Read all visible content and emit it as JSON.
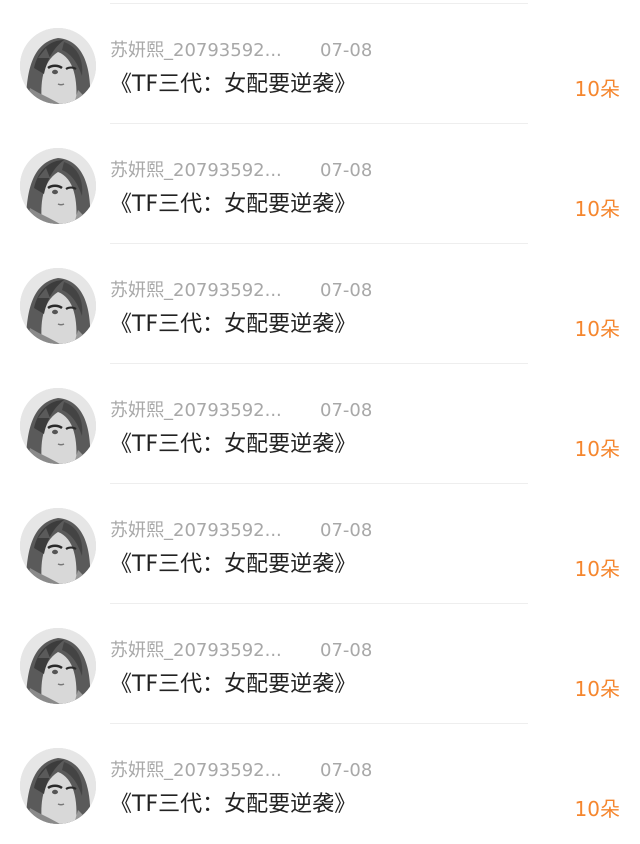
{
  "rows": [
    {
      "username": "苏妍熙_20793592...",
      "date": "07-08",
      "title": "《TF三代：女配要逆袭》",
      "amount": "10朵"
    },
    {
      "username": "苏妍熙_20793592...",
      "date": "07-08",
      "title": "《TF三代：女配要逆袭》",
      "amount": "10朵"
    },
    {
      "username": "苏妍熙_20793592...",
      "date": "07-08",
      "title": "《TF三代：女配要逆袭》",
      "amount": "10朵"
    },
    {
      "username": "苏妍熙_20793592...",
      "date": "07-08",
      "title": "《TF三代：女配要逆袭》",
      "amount": "10朵"
    },
    {
      "username": "苏妍熙_20793592...",
      "date": "07-08",
      "title": "《TF三代：女配要逆袭》",
      "amount": "10朵"
    },
    {
      "username": "苏妍熙_20793592...",
      "date": "07-08",
      "title": "《TF三代：女配要逆袭》",
      "amount": "10朵"
    },
    {
      "username": "苏妍熙_20793592...",
      "date": "07-08",
      "title": "《TF三代：女配要逆袭》",
      "amount": "10朵"
    }
  ],
  "colors": {
    "amount": "#f5862e",
    "meta_text": "#a8a8a8",
    "title_text": "#222222",
    "separator": "#eeeeee"
  },
  "icons": {
    "avatar": "anime-girl-avatar-grayscale"
  }
}
